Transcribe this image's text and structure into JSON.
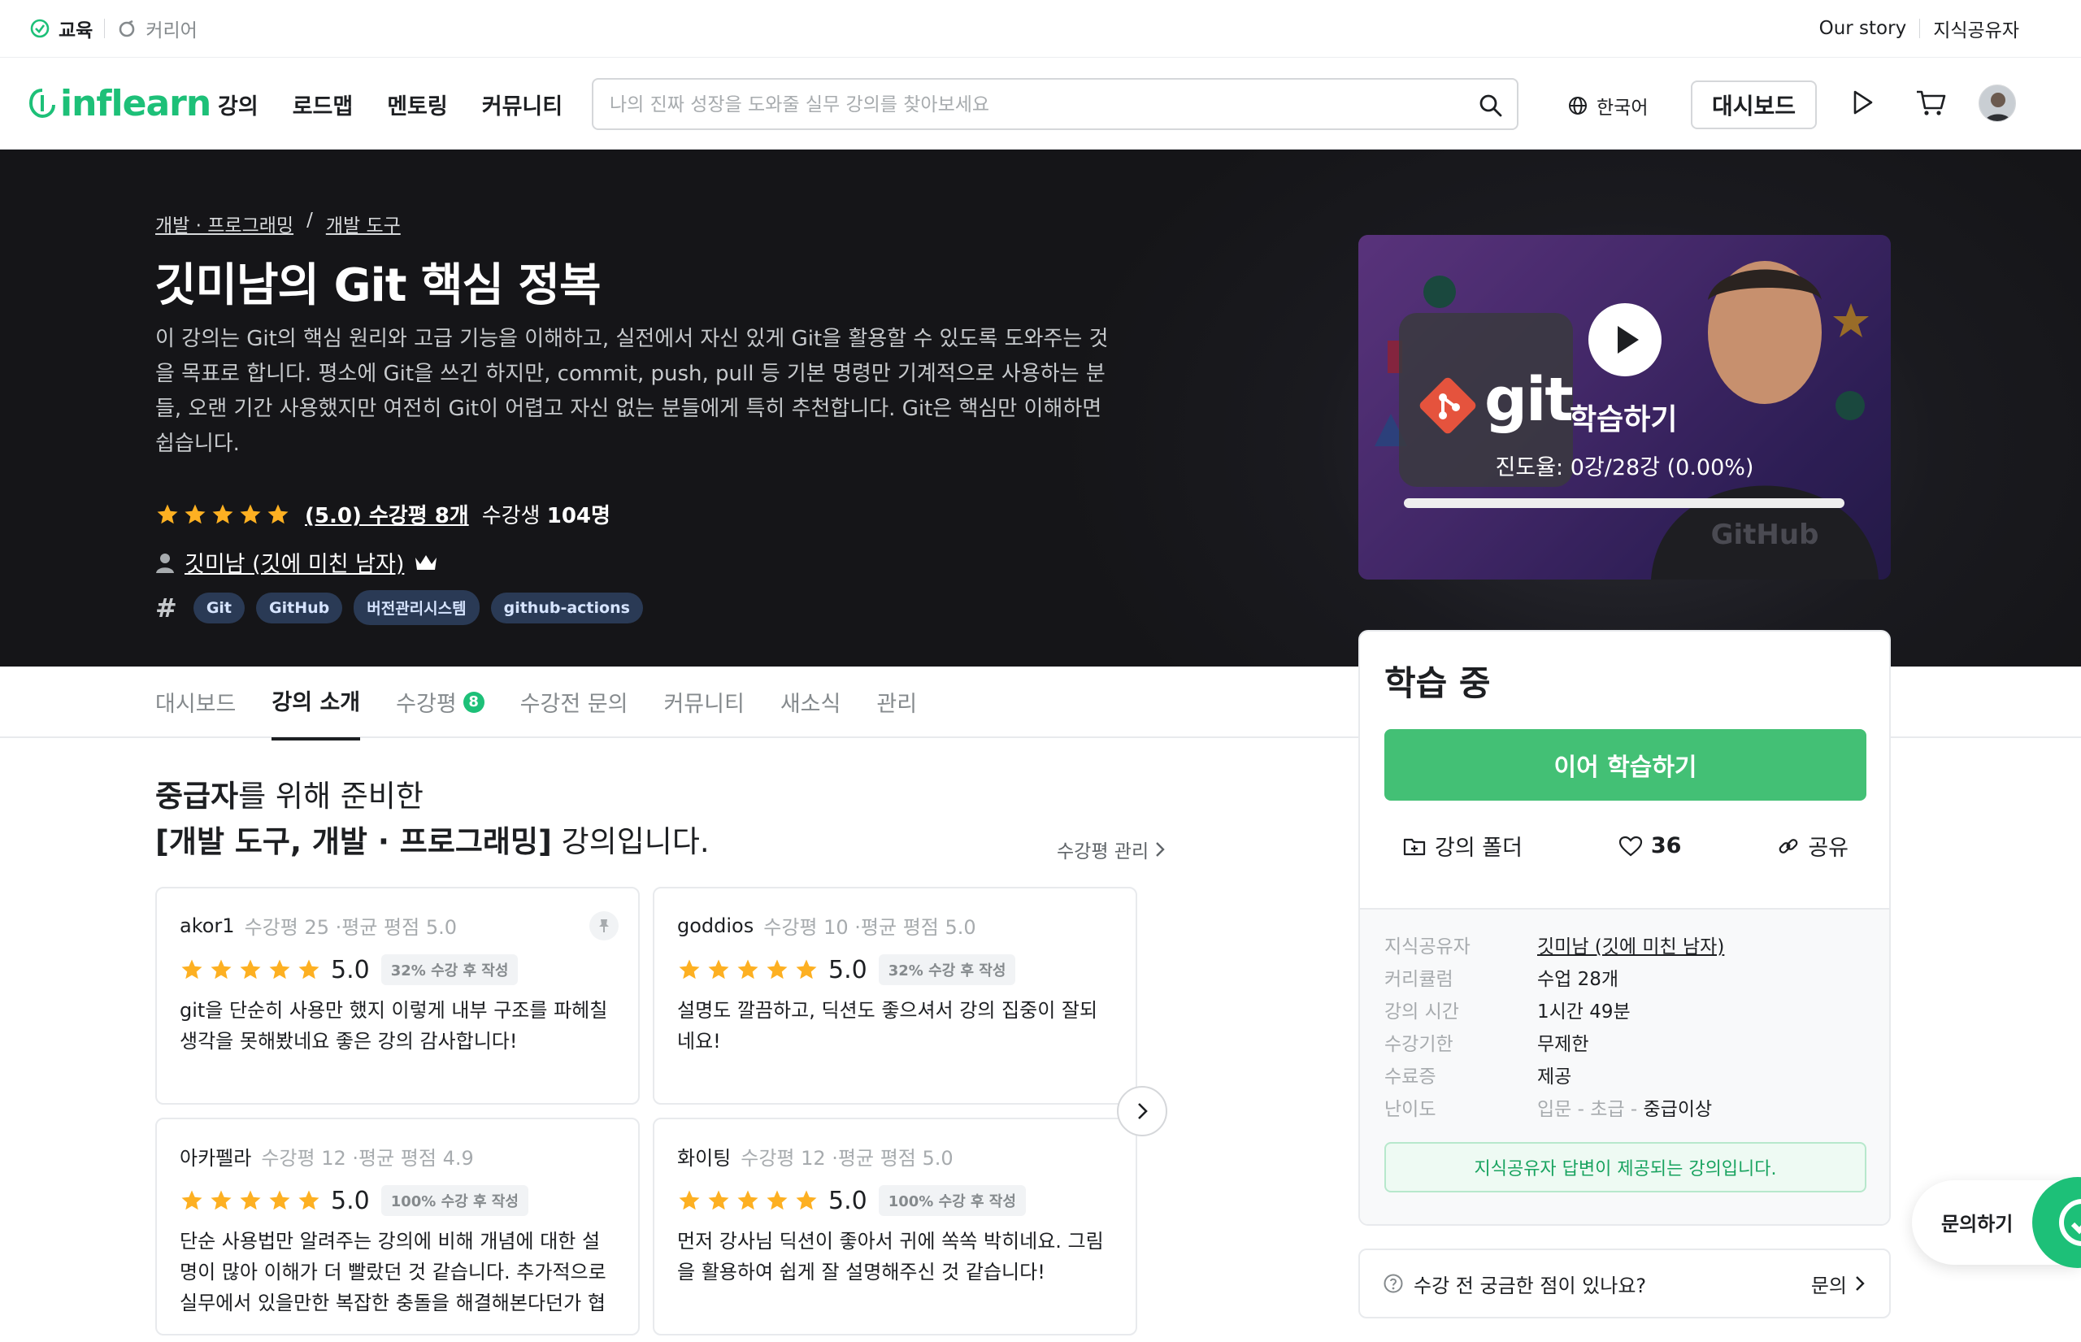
{
  "utilbar": {
    "education_label": "교육",
    "career_label": "커리어",
    "our_story": "Our story",
    "instructor_link": "지식공유자"
  },
  "header": {
    "logo_text": "inflearn",
    "nav": [
      "강의",
      "로드맵",
      "멘토링",
      "커뮤니티"
    ],
    "search_placeholder": "나의 진짜 성장을 도와줄 실무 강의를 찾아보세요",
    "language": "한국어",
    "dashboard_label": "대시보드"
  },
  "hero": {
    "breadcrumb": [
      "개발 · 프로그래밍",
      "개발 도구"
    ],
    "breadcrumb_sep": "/",
    "title": "깃미남의 Git 핵심 정복",
    "description": "이 강의는 Git의 핵심 원리와 고급 기능을 이해하고, 실전에서 자신 있게 Git을 활용할 수 있도록 도와주는 것을 목표로 합니다. 평소에 Git을 쓰긴 하지만, commit, push, pull 등 기본 명령만 기계적으로 사용하는 분들, 오랜 기간 사용했지만 여전히 Git이 어렵고 자신 없는 분들에게 특히 추천합니다. Git은 핵심만 이해하면 쉽습니다.",
    "rating_link": "(5.0) 수강평 8개",
    "students_prefix": "수강생",
    "students_count": "104명",
    "instructor": "깃미남 (깃에 미친 남자)",
    "tags": [
      "Git",
      "GitHub",
      "버전관리시스템",
      "github-actions"
    ]
  },
  "video": {
    "logo_word": "git",
    "learn_label": "학습하기",
    "progress_text": "진도율: 0강/28강 (0.00%)",
    "progress_fraction": 0.0
  },
  "tabs": [
    {
      "label": "대시보드",
      "active": false
    },
    {
      "label": "강의 소개",
      "active": true
    },
    {
      "label": "수강평",
      "active": false,
      "badge": "8"
    },
    {
      "label": "수강전 문의",
      "active": false
    },
    {
      "label": "커뮤니티",
      "active": false
    },
    {
      "label": "새소식",
      "active": false
    },
    {
      "label": "관리",
      "active": false
    }
  ],
  "intro": {
    "line1_bold": "중급자",
    "line1_rest": "를 위해 준비한",
    "line2_bold": "[개발 도구, 개발 · 프로그래밍]",
    "line2_rest": " 강의입니다.",
    "review_manage": "수강평 관리"
  },
  "reviews": [
    {
      "user": "akor1",
      "meta": "수강평 25 ·평균 평점 5.0",
      "score": "5.0",
      "chip": "32% 수강 후 작성",
      "body": "git을 단순히 사용만 했지 이렇게 내부 구조를 파헤칠 생각을 못해봤네요 좋은 강의 감사합니다!"
    },
    {
      "user": "goddios",
      "meta": "수강평 10 ·평균 평점 5.0",
      "score": "5.0",
      "chip": "32% 수강 후 작성",
      "body": "설명도 깔끔하고, 딕션도 좋으셔서 강의 집중이 잘되네요!"
    },
    {
      "user": "아카펠라",
      "meta": "수강평 12 ·평균 평점 4.9",
      "score": "5.0",
      "chip": "100% 수강 후 작성",
      "body": "단순 사용법만 알려주는 강의에 비해 개념에 대한 설명이 많아 이해가 더 빨랐던 것 같습니다. 추가적으로 실무에서 있을만한 복잡한 충돌을 해결해본다던가 협업과 ..."
    },
    {
      "user": "화이팅",
      "meta": "수강평 12 ·평균 평점 5.0",
      "score": "5.0",
      "chip": "100% 수강 후 작성",
      "body": "먼저 강사님 딕션이 좋아서 귀에 쏙쏙 박히네요. 그림을 활용하여 쉽게 잘 설명해주신 것 같습니다!"
    }
  ],
  "side": {
    "title": "학습 중",
    "continue_label": "이어 학습하기",
    "folder_label": "강의 폴더",
    "like_count": "36",
    "share_label": "공유",
    "info": {
      "instructor_key": "지식공유자",
      "instructor_val": "깃미남 (깃에 미친 남자)",
      "curriculum_key": "커리큘럼",
      "curriculum_val": "수업 28개",
      "duration_key": "강의 시간",
      "duration_val": "1시간 49분",
      "period_key": "수강기한",
      "period_val": "무제한",
      "cert_key": "수료증",
      "cert_val": "제공",
      "level_key": "난이도",
      "level_1": "입문",
      "level_2": "초급",
      "level_3": "중급이상",
      "level_sep": " - "
    },
    "notice": "지식공유자 답변이 제공되는 강의입니다."
  },
  "question": {
    "text": "수강 전 궁금한 점이 있나요?",
    "link": "문의"
  },
  "float_contact": "문의하기",
  "colors": {
    "brand_green": "#1dc078",
    "button_green": "#43c075",
    "star": "#fdb022",
    "tag_bg": "#2a3a55"
  }
}
